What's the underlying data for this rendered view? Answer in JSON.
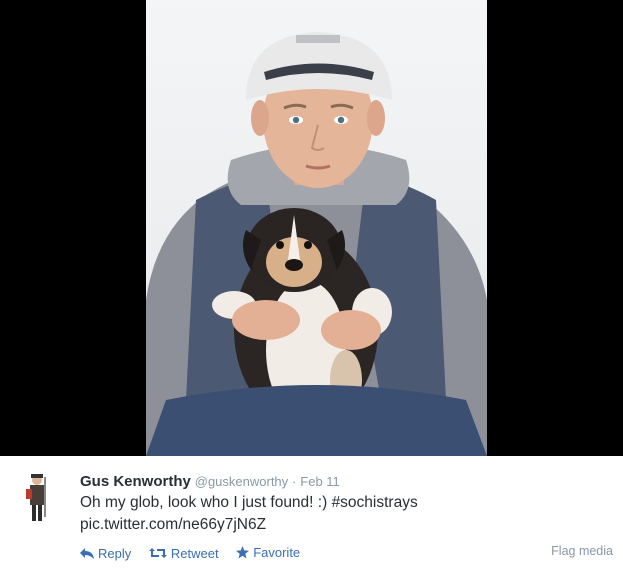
{
  "tweet": {
    "fullname": "Gus Kenworthy",
    "username": "@guskenworthy",
    "separator": "·",
    "date": "Feb 11",
    "text_line1": "Oh my glob, look who I just found! :) #sochistrays",
    "text_line2": "pic.twitter.com/ne66y7jN6Z"
  },
  "actions": {
    "reply": "Reply",
    "retweet": "Retweet",
    "favorite": "Favorite",
    "flag": "Flag media"
  },
  "colors": {
    "link": "#3b6fb5",
    "muted": "#8899a6",
    "text": "#292f33"
  }
}
